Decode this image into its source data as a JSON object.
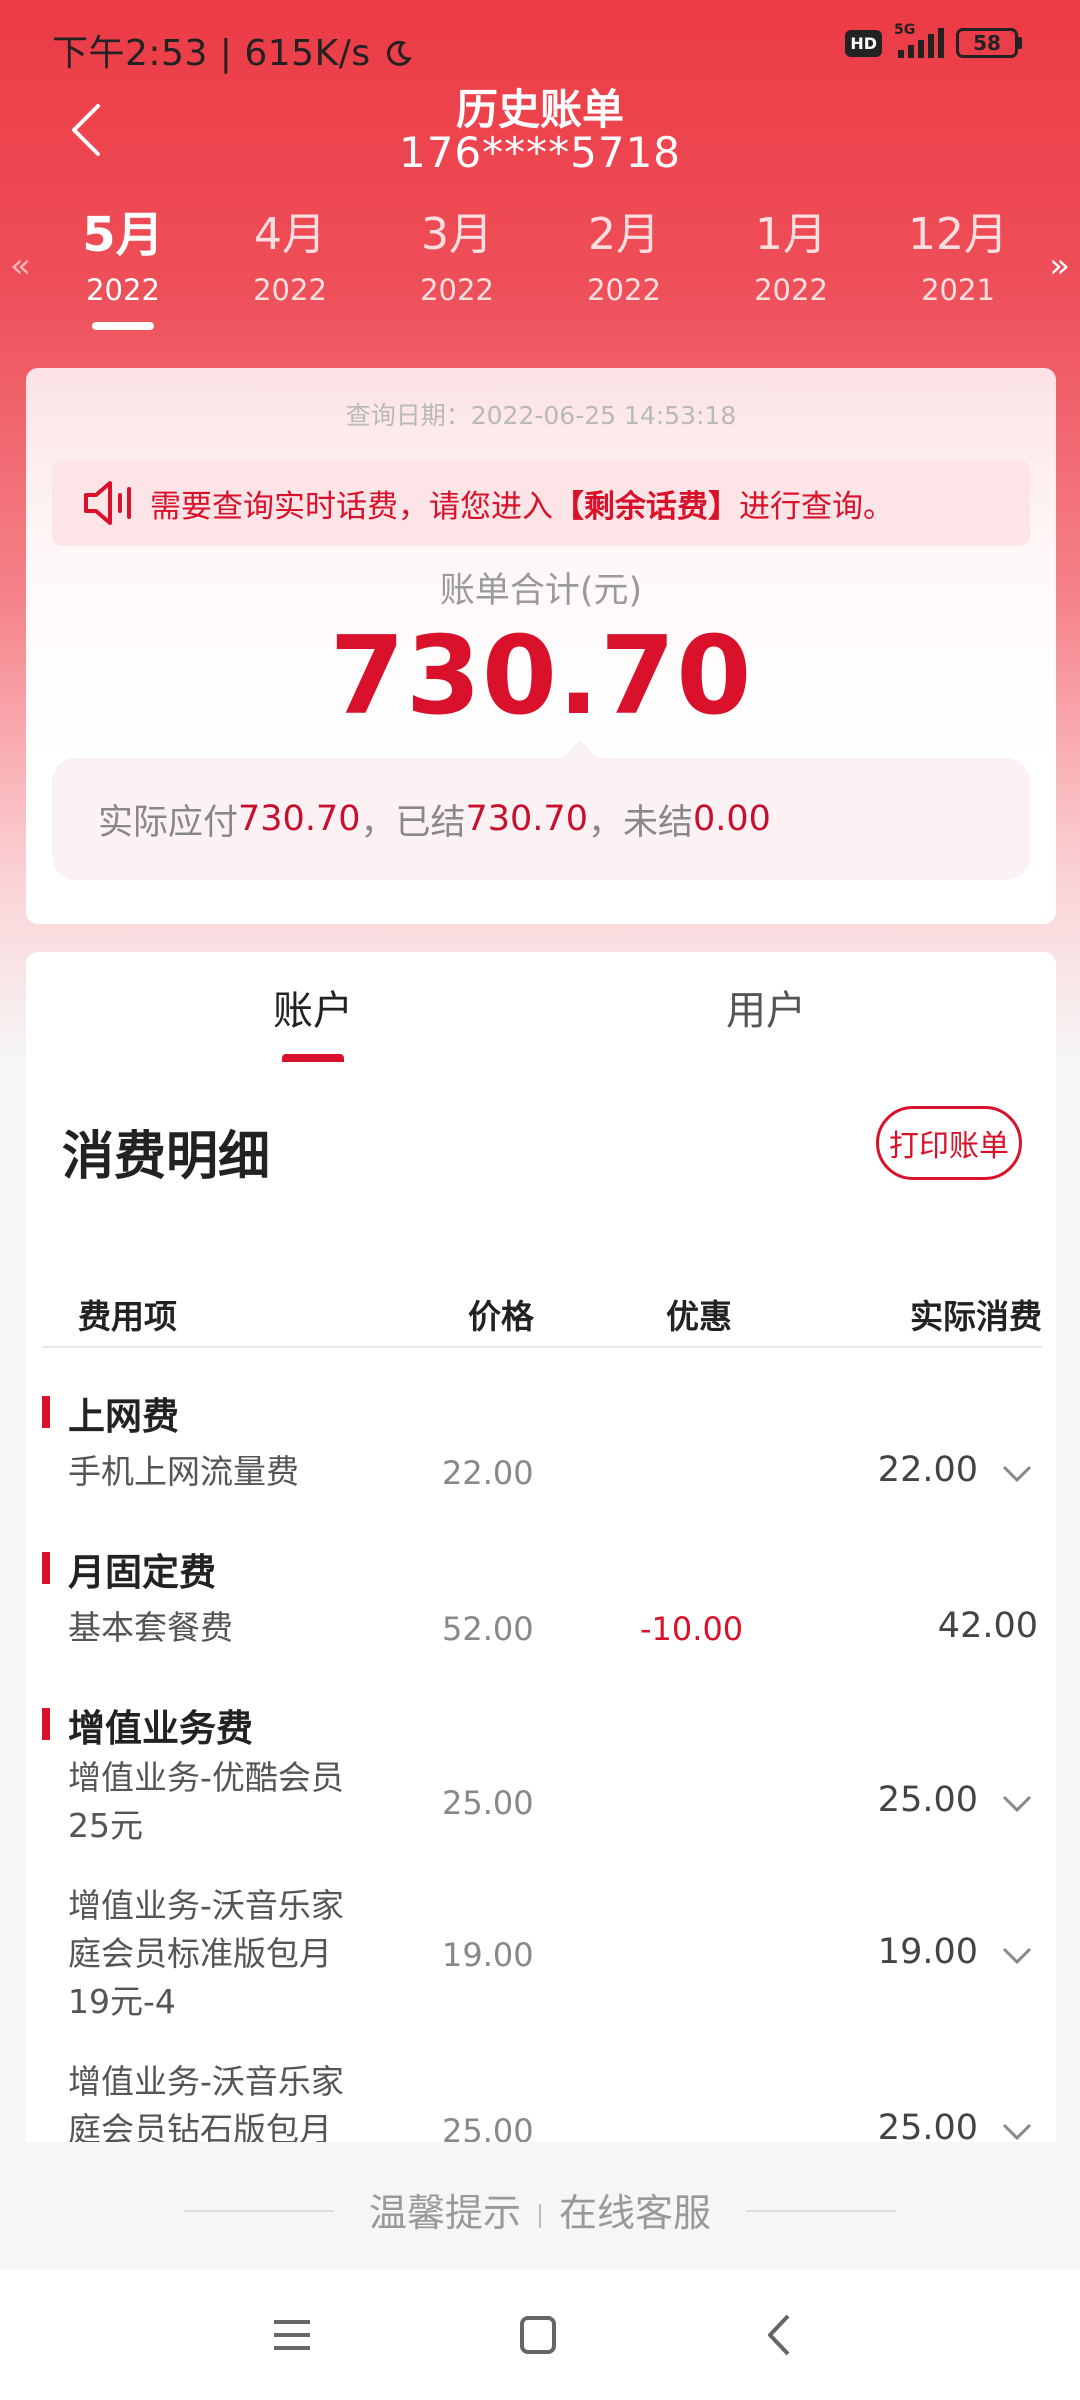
{
  "status": {
    "time": "下午2:53",
    "speed": "615K/s",
    "hd": "HD",
    "network": "5G",
    "battery": "58"
  },
  "nav": {
    "title": "历史账单",
    "phone": "176****5718"
  },
  "months": [
    {
      "month": "5月",
      "year": "2022",
      "active": true
    },
    {
      "month": "4月",
      "year": "2022"
    },
    {
      "month": "3月",
      "year": "2022"
    },
    {
      "month": "2月",
      "year": "2022"
    },
    {
      "month": "1月",
      "year": "2022"
    },
    {
      "month": "12月",
      "year": "2021"
    }
  ],
  "bill": {
    "query_date": "查询日期：2022-06-25 14:53:18",
    "notice_prefix": "需要查询实时话费，请您进入",
    "notice_link": "【剩余话费】",
    "notice_suffix": "进行查询。",
    "total_label": "账单合计(元)",
    "total_amount": "730.70",
    "summary": {
      "payable_label": "实际应付",
      "payable": "730.70",
      "settled_label": "，已结",
      "settled": "730.70",
      "unsettled_label": "，未结",
      "unsettled": "0.00"
    }
  },
  "tabs": [
    {
      "label": "账户",
      "active": true
    },
    {
      "label": "用户"
    }
  ],
  "detail": {
    "title": "消费明细",
    "print_button": "打印账单",
    "columns": [
      "费用项",
      "价格",
      "优惠",
      "实际消费"
    ],
    "sections": [
      {
        "title": "上网费"
      },
      {
        "title": "月固定费"
      },
      {
        "title": "增值业务费"
      }
    ],
    "rows": [
      {
        "name": "手机上网流量费",
        "price": "22.00",
        "discount": "",
        "actual": "22.00"
      },
      {
        "name": "基本套餐费",
        "price": "52.00",
        "discount": "-10.00",
        "actual": "42.00"
      },
      {
        "name": "增值业务-优酷会员25元",
        "price": "25.00",
        "discount": "",
        "actual": "25.00"
      },
      {
        "name": "增值业务-沃音乐家庭会员标准版包月19元-4",
        "price": "19.00",
        "discount": "",
        "actual": "19.00"
      },
      {
        "name": "增值业务-沃音乐家庭会员钻石版包月",
        "price": "25.00",
        "discount": "",
        "actual": "25.00"
      }
    ]
  },
  "footer": {
    "tips": "温馨提示",
    "service": "在线客服"
  },
  "colors": {
    "brand_red": "#d9112a",
    "header_red": "#ec3b45"
  }
}
